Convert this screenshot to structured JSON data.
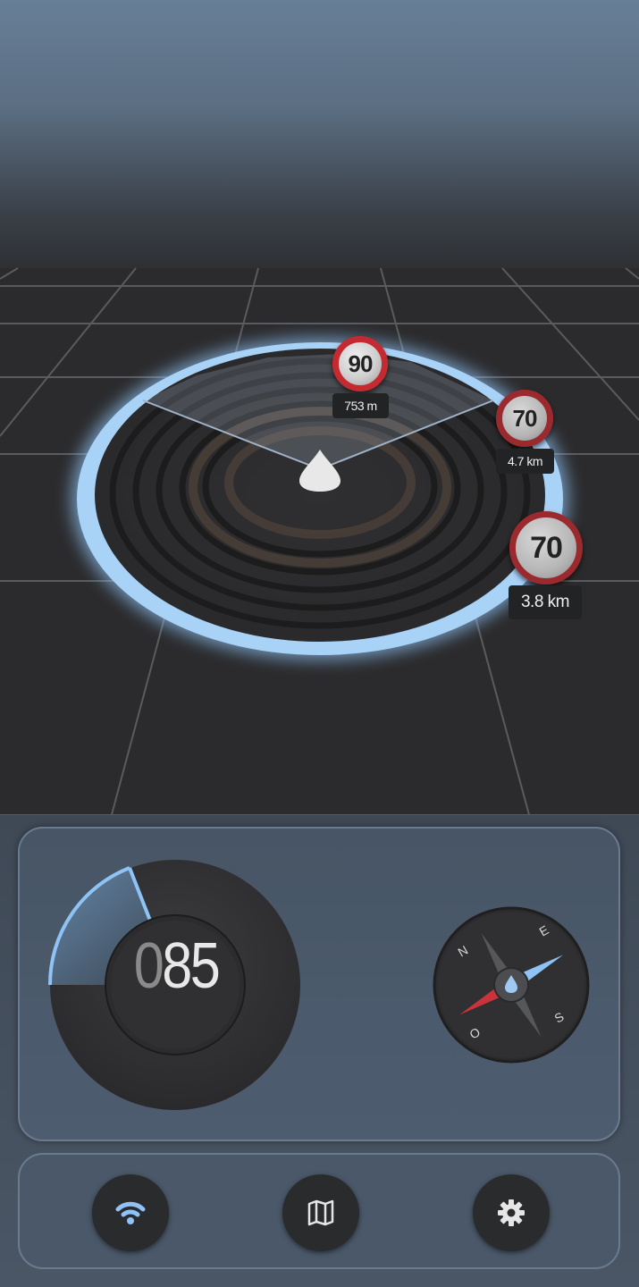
{
  "radar": {
    "signs": [
      {
        "limit": "90",
        "distance": "753 m"
      },
      {
        "limit": "70",
        "distance": "4.7 km"
      },
      {
        "limit": "70",
        "distance": "3.8 km"
      }
    ],
    "ring_color": "#8fc3f5"
  },
  "speedometer": {
    "leading_digit": "0",
    "speed_digits": "85",
    "accent": "#8fc3f5"
  },
  "compass": {
    "labels": {
      "north": "N",
      "east": "E",
      "south": "S",
      "west": "O"
    },
    "icon": "drop-icon"
  },
  "nav": {
    "items": [
      {
        "name": "wifi-icon"
      },
      {
        "name": "map-icon"
      },
      {
        "name": "gear-icon"
      }
    ]
  }
}
